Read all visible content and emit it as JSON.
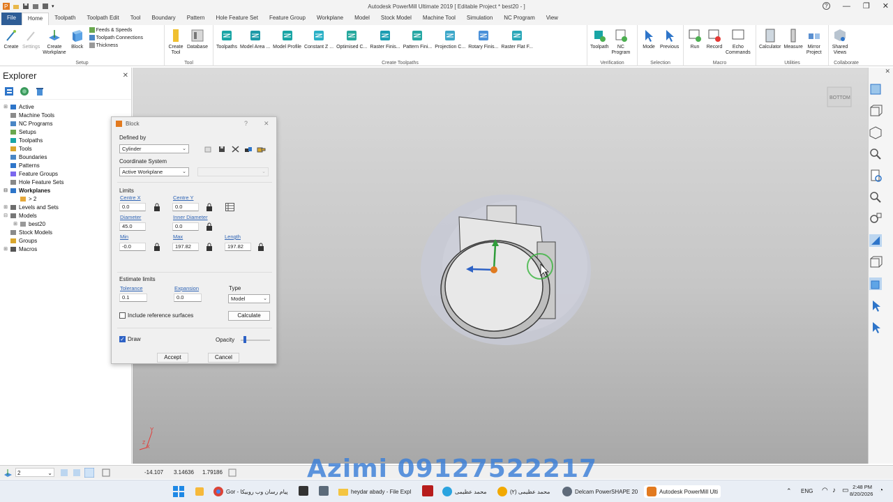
{
  "app": {
    "title": "Autodesk PowerMill Ultimate 2019   [ Editable Project * best20 - ]",
    "help": "?"
  },
  "tabs": [
    "File",
    "Home",
    "Toolpath",
    "Toolpath Edit",
    "Tool",
    "Boundary",
    "Pattern",
    "Hole Feature Set",
    "Feature Group",
    "Workplane",
    "Model",
    "Stock Model",
    "Machine Tool",
    "Simulation",
    "NC Program",
    "View"
  ],
  "ribbon": {
    "setup": {
      "label": "Setup",
      "create": "Create",
      "settings": "Settings",
      "create_workplane": "Create\nWorkplane",
      "block": "Block",
      "feeds": "Feeds & Speeds",
      "connections": "Toolpath Connections",
      "thickness": "Thickness"
    },
    "tool": {
      "label": "Tool",
      "create_tool": "Create\nTool",
      "database": "Database"
    },
    "create_toolpaths": {
      "label": "Create Toolpaths",
      "items": [
        "Toolpaths",
        "Model Area ...",
        "Model Profile",
        "Constant Z ...",
        "Optimised C...",
        "Raster Finis...",
        "Pattern Fini...",
        "Projection C...",
        "Rotary Finis...",
        "Raster Flat F..."
      ]
    },
    "verification": {
      "label": "Verification",
      "toolpath": "Toolpath",
      "nc_program": "NC\nProgram"
    },
    "selection": {
      "label": "Selection",
      "mode": "Mode",
      "previous": "Previous"
    },
    "macro": {
      "label": "Macro",
      "run": "Run",
      "record": "Record",
      "echo": "Echo\nCommands"
    },
    "utilities": {
      "label": "Utilities",
      "calculator": "Calculator",
      "measure": "Measure",
      "mirror": "Mirror\nProject"
    },
    "collaborate": {
      "label": "Collaborate",
      "shared": "Shared\nViews"
    }
  },
  "explorer": {
    "title": "Explorer",
    "nodes": [
      {
        "label": "Active",
        "indent": 0,
        "exp": "+",
        "bold": false
      },
      {
        "label": "Machine Tools",
        "indent": 0,
        "exp": "",
        "bold": false
      },
      {
        "label": "NC Programs",
        "indent": 0,
        "exp": "",
        "bold": false
      },
      {
        "label": "Setups",
        "indent": 0,
        "exp": "",
        "bold": false
      },
      {
        "label": "Toolpaths",
        "indent": 0,
        "exp": "",
        "bold": false
      },
      {
        "label": "Tools",
        "indent": 0,
        "exp": "",
        "bold": false
      },
      {
        "label": "Boundaries",
        "indent": 0,
        "exp": "",
        "bold": false
      },
      {
        "label": "Patterns",
        "indent": 0,
        "exp": "",
        "bold": false
      },
      {
        "label": "Feature Groups",
        "indent": 0,
        "exp": "",
        "bold": false
      },
      {
        "label": "Hole Feature Sets",
        "indent": 0,
        "exp": "",
        "bold": false
      },
      {
        "label": "Workplanes",
        "indent": 0,
        "exp": "-",
        "bold": true
      },
      {
        "label": "> 2",
        "indent": 1,
        "exp": "",
        "bold": false
      },
      {
        "label": "Levels and Sets",
        "indent": 0,
        "exp": "+",
        "bold": false
      },
      {
        "label": "Models",
        "indent": 0,
        "exp": "-",
        "bold": false
      },
      {
        "label": "best20",
        "indent": 1,
        "exp": "+",
        "bold": false
      },
      {
        "label": "Stock Models",
        "indent": 0,
        "exp": "",
        "bold": false
      },
      {
        "label": "Groups",
        "indent": 0,
        "exp": "",
        "bold": false
      },
      {
        "label": "Macros",
        "indent": 0,
        "exp": "+",
        "bold": false
      }
    ]
  },
  "dialog": {
    "title": "Block",
    "help": "?",
    "defined_by_label": "Defined by",
    "defined_by": "Cylinder",
    "coord_label": "Coordinate System",
    "coord": "Active Workplane",
    "limits_label": "Limits",
    "centre_x_label": "Centre X",
    "centre_x": "0.0",
    "centre_y_label": "Centre Y",
    "centre_y": "0.0",
    "diameter_label": "Diameter",
    "diameter": "45.0",
    "inner_label": "Inner Diameter",
    "inner": "0.0",
    "min_label": "Min",
    "min": "-0.0",
    "max_label": "Max",
    "max": "197.82",
    "length_label": "Length",
    "length": "197.82",
    "estimate_label": "Estimate limits",
    "tolerance_label": "Tolerance",
    "tolerance": "0.1",
    "expansion_label": "Expansion",
    "expansion": "0.0",
    "type_label": "Type",
    "type": "Model",
    "include_ref": "Include reference surfaces",
    "calculate": "Calculate",
    "draw": "Draw",
    "opacity": "Opacity",
    "opacity_level": 0.15,
    "accept": "Accept",
    "cancel": "Cancel"
  },
  "viewport": {
    "cube_label": "BOTTOM",
    "axis_y": "Y",
    "axis_z": "Z",
    "axis_x": "X"
  },
  "status": {
    "workplane": "2",
    "x": "-14.107",
    "y": "3.14636",
    "z": "1.79186"
  },
  "watermark": "Azimi  09127522217",
  "taskbar": {
    "items": [
      "Gor - پیام رسان وب روبیکا",
      "heydar abady - File Expl",
      "محمد عظیمی",
      "محمد عظیمی (۲)",
      "Delcam PowerSHAPE 20",
      "Autodesk PowerMill Ulti"
    ],
    "lang": "ENG",
    "time": "2:48 PM",
    "date": "8/20/2026"
  },
  "colors": {
    "file_tab": "#2e5d96",
    "accent": "#2f64b5",
    "ribbon_icon_teal": "#19a5a5",
    "link": "#2f64b5"
  }
}
